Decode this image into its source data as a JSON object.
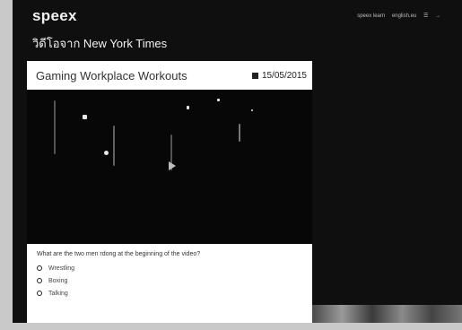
{
  "app": {
    "logo": "speex"
  },
  "header": {
    "subtitle": "วิดีโอจาก New York Times",
    "top_right_items": [
      "speex learn",
      "english.eu",
      "☰",
      "→"
    ]
  },
  "video_card": {
    "title": "Gaming Workplace Workouts",
    "date": "15/05/2015",
    "question": "What are the two men rdong at the beginning of the video?",
    "options": [
      "Wrestling",
      "Boxing",
      "Talking"
    ]
  },
  "sidebar": {
    "heading": "",
    "paragraphs": [
      "",
      ""
    ],
    "bullets": [
      "",
      "",
      "",
      ""
    ],
    "footer_left": "",
    "footer_right": ""
  }
}
